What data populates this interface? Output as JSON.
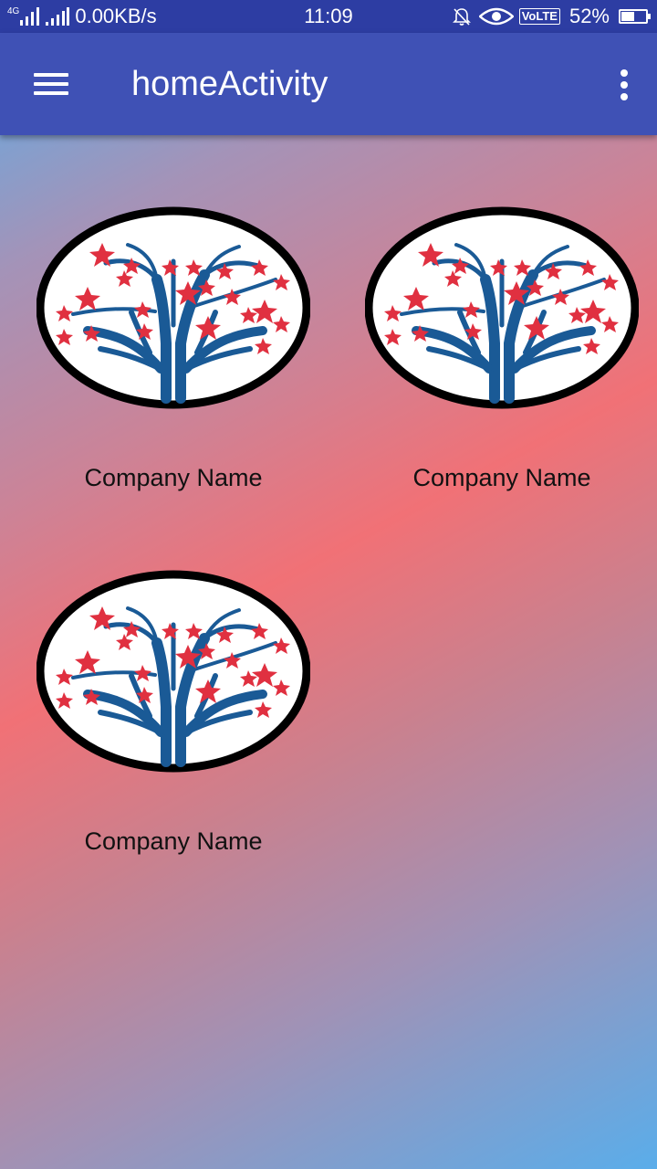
{
  "status_bar": {
    "network_tag": "4G",
    "speed": "0.00KB/s",
    "time": "11:09",
    "volte": "VoLTE",
    "battery_percent": "52%",
    "battery_level": 0.52,
    "icons": [
      "signal-icon",
      "mute-icon",
      "eye-icon",
      "battery-icon"
    ]
  },
  "app_bar": {
    "title": "homeActivity",
    "menu_icon": "hamburger-menu-icon",
    "overflow_icon": "more-vert-icon",
    "color": "#3f51b5"
  },
  "companies": [
    {
      "name": "Company Name",
      "logo": "tree-hands-stars-logo"
    },
    {
      "name": "Company Name",
      "logo": "tree-hands-stars-logo"
    },
    {
      "name": "Company Name",
      "logo": "tree-hands-stars-logo"
    }
  ],
  "colors": {
    "status_bar": "#2d3da3",
    "logo_blue": "#1a5a96",
    "logo_star": "#e03040"
  }
}
